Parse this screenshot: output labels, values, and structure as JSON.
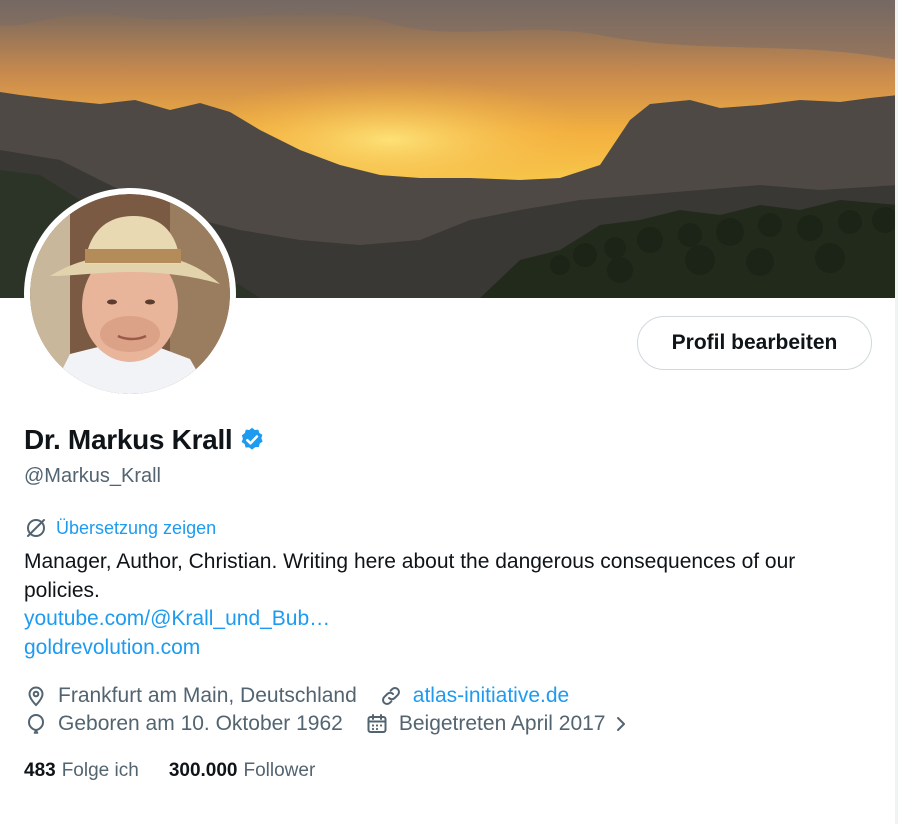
{
  "profile": {
    "display_name": "Dr. Markus Krall",
    "handle": "@Markus_Krall",
    "verified_icon": "verified-badge-icon",
    "edit_button_label": "Profil bearbeiten",
    "translate_label": "Übersetzung zeigen",
    "bio": "Manager, Author, Christian. Writing here about the dangerous consequences of our policies.",
    "bio_links": [
      "youtube.com/@Krall_und_Bub…",
      "goldrevolution.com"
    ],
    "location": "Frankfurt am Main, Deutschland",
    "website": "atlas-initiative.de",
    "birthday": "Geboren am 10. Oktober 1962",
    "joined": "Beigetreten April 2017"
  },
  "stats": {
    "following_count": "483",
    "following_label": "Folge ich",
    "followers_count": "300.000",
    "followers_label": "Follower"
  },
  "colors": {
    "accent": "#1d9bf0",
    "text_primary": "#0f1419",
    "text_secondary": "#536471",
    "border": "#cfd9de"
  }
}
